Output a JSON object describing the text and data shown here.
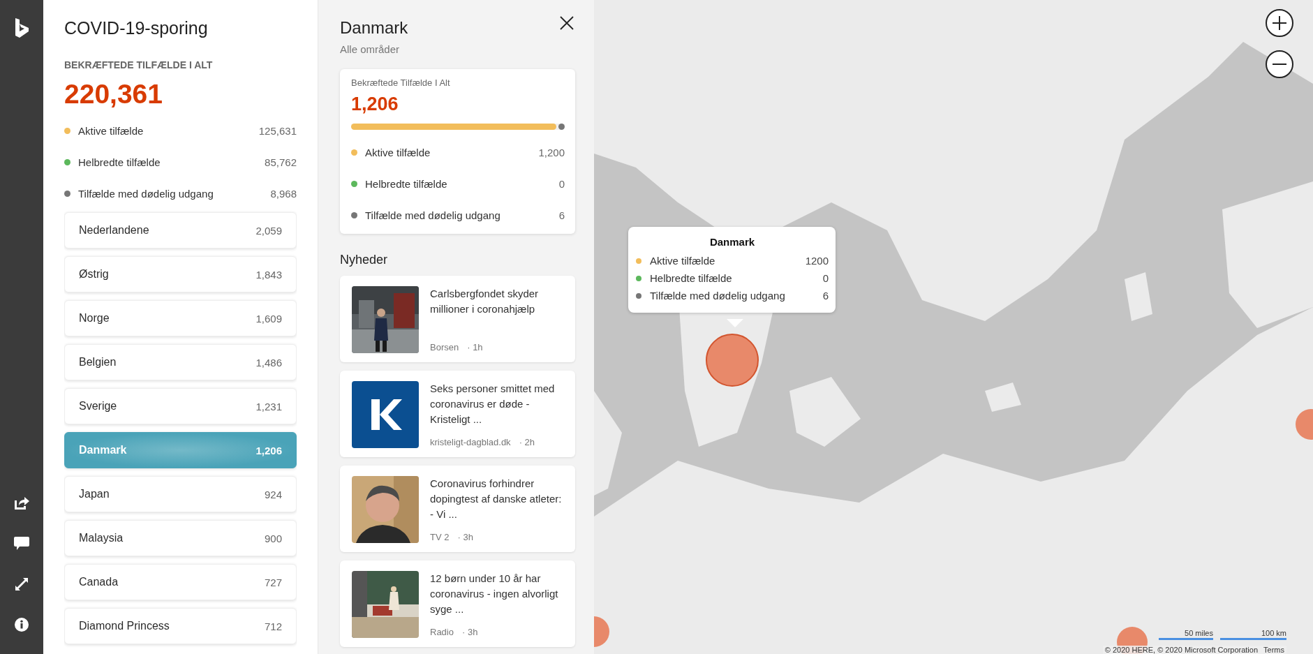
{
  "tracker": {
    "title": "COVID-19-sporing",
    "total_label": "BEKRÆFTEDE TILFÆLDE I ALT",
    "total": "220,361",
    "breakdown": [
      {
        "label": "Aktive tilfælde",
        "value": "125,631",
        "color": "#f2bd5b"
      },
      {
        "label": "Helbredte tilfælde",
        "value": "85,762",
        "color": "#5cb85c"
      },
      {
        "label": "Tilfælde med dødelig udgang",
        "value": "8,968",
        "color": "#767676"
      }
    ],
    "countries": [
      {
        "name": "Nederlandene",
        "count": "2,059",
        "selected": false
      },
      {
        "name": "Østrig",
        "count": "1,843",
        "selected": false
      },
      {
        "name": "Norge",
        "count": "1,609",
        "selected": false
      },
      {
        "name": "Belgien",
        "count": "1,486",
        "selected": false
      },
      {
        "name": "Sverige",
        "count": "1,231",
        "selected": false
      },
      {
        "name": "Danmark",
        "count": "1,206",
        "selected": true
      },
      {
        "name": "Japan",
        "count": "924",
        "selected": false
      },
      {
        "name": "Malaysia",
        "count": "900",
        "selected": false
      },
      {
        "name": "Canada",
        "count": "727",
        "selected": false
      },
      {
        "name": "Diamond Princess",
        "count": "712",
        "selected": false
      }
    ]
  },
  "detail": {
    "title": "Danmark",
    "subtitle": "Alle områder",
    "card": {
      "label": "Bekræftede Tilfælde I Alt",
      "total": "1,206",
      "level": 0.96,
      "breakdown": [
        {
          "label": "Aktive tilfælde",
          "value": "1,200",
          "color": "#f2bd5b"
        },
        {
          "label": "Helbredte tilfælde",
          "value": "0",
          "color": "#5cb85c"
        },
        {
          "label": "Tilfælde med dødelig udgang",
          "value": "6",
          "color": "#767676"
        }
      ]
    },
    "news_heading": "Nyheder",
    "news": [
      {
        "headline": "Carlsbergfondet skyder millioner i coronahjælp",
        "source": "Borsen",
        "age": "· 1h",
        "kind": "picture"
      },
      {
        "headline": "Seks personer smittet med coronavirus er døde - Kristeligt ...",
        "source": "kristeligt-dagblad.dk",
        "age": "· 2h",
        "kind": "picture"
      },
      {
        "headline": "Coronavirus forhindrer dopingtest af danske atleter: - Vi ...",
        "source": "TV 2",
        "age": "· 3h",
        "kind": "picture"
      },
      {
        "headline": "12 børn under 10 år har coronavirus - ingen alvorligt syge ...",
        "source": "Radio",
        "age": "· 3h",
        "kind": "picture"
      }
    ]
  },
  "map": {
    "tooltip": {
      "title": "Danmark",
      "rows": [
        {
          "label": "Aktive tilfælde",
          "value": "1200",
          "color": "#f2bd5b"
        },
        {
          "label": "Helbredte tilfælde",
          "value": "0",
          "color": "#5cb85c"
        },
        {
          "label": "Tilfælde med dødelig udgang",
          "value": "6",
          "color": "#767676"
        }
      ]
    },
    "scale": [
      "50 miles",
      "100 km"
    ],
    "attribution": "© 2020 HERE, © 2020 Microsoft Corporation",
    "terms": "Terms"
  }
}
